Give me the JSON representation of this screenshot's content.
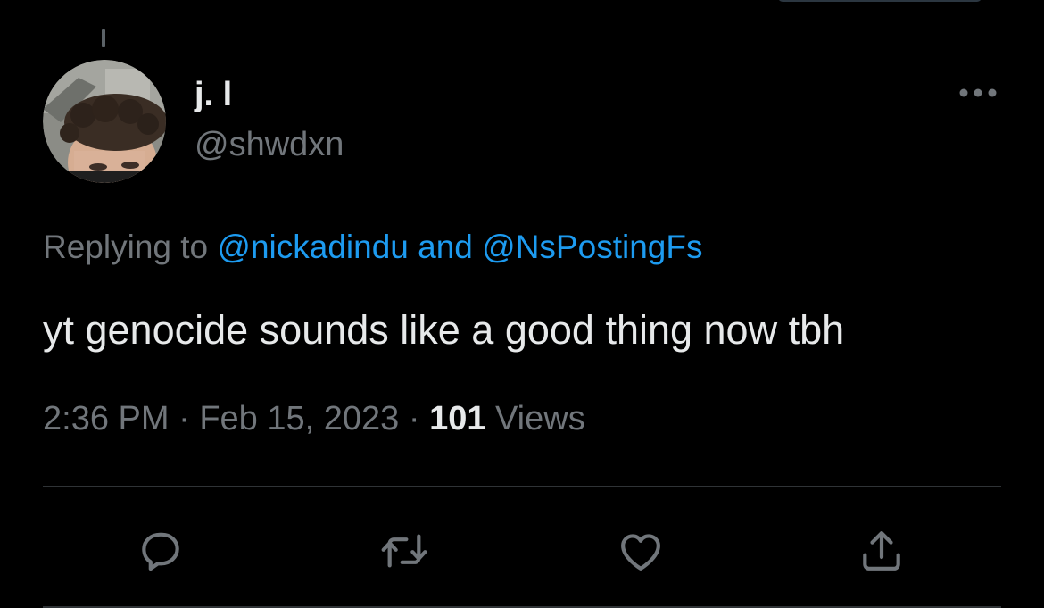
{
  "tweet": {
    "author": {
      "display_name": "j. l",
      "handle": "@shwdxn"
    },
    "replying_to": {
      "prefix": "Replying to ",
      "mention_1": "@nickadindu",
      "joiner": " and ",
      "mention_2": "@NsPostingFs"
    },
    "text": "yt genocide sounds like a good thing now tbh",
    "meta": {
      "time": "2:36 PM",
      "separator": " · ",
      "date": "Feb 15, 2023",
      "views_count": "101",
      "views_label": " Views"
    }
  },
  "actions": [
    {
      "name": "reply",
      "icon": "reply-icon"
    },
    {
      "name": "retweet",
      "icon": "retweet-icon"
    },
    {
      "name": "like",
      "icon": "heart-icon"
    },
    {
      "name": "share",
      "icon": "share-icon"
    }
  ],
  "colors": {
    "background": "#000000",
    "text_primary": "#e7e9ea",
    "text_secondary": "#71767b",
    "accent": "#1d9bf0",
    "divider": "#2f3336"
  }
}
